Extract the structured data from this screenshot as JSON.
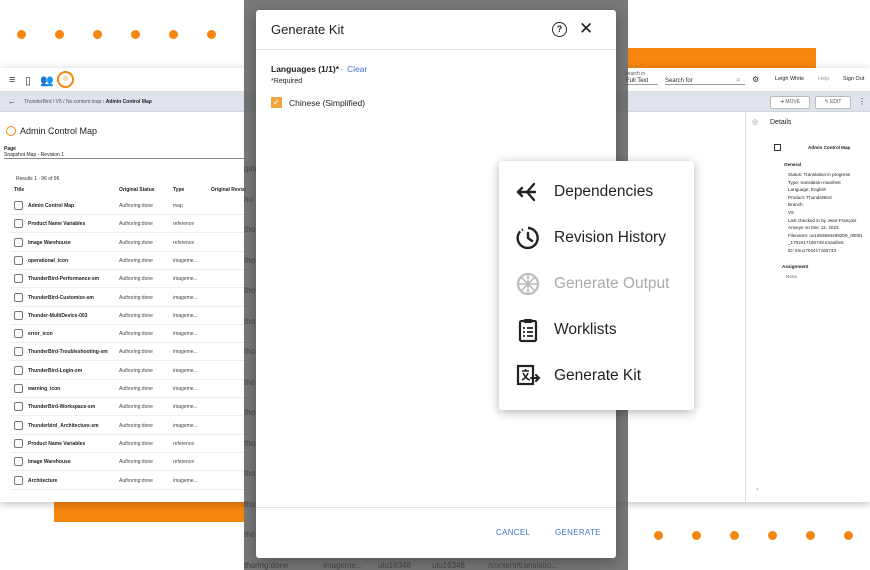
{
  "colors": {
    "accent": "#f5860f",
    "link": "#3b78c4",
    "checkbox": "#f0a33a"
  },
  "app": {
    "search": {
      "scope_label": "Search in",
      "scope_value": "Full Text",
      "placeholder": "Search for"
    },
    "user": "Leigh White",
    "help": "Help",
    "sign_out": "Sign Out",
    "breadcrumb_prefix": "ThunderBird / V5 / No content map  ›",
    "breadcrumb_current": "Admin Control Map",
    "move_label": "MOVE",
    "edit_label": "EDIT",
    "page_title": "Admin Control Map",
    "page_label": "Page",
    "page_value": "Snapshot Map - Revision 1",
    "results": "Results 1 - 96 of 96",
    "columns": [
      "Title",
      "Original Status",
      "Type",
      "Original Revisi"
    ],
    "rows": [
      {
        "title": "Admin Control Map",
        "status": "Authoring:done",
        "type": "map"
      },
      {
        "title": "Product Name Variables",
        "status": "Authoring:done",
        "type": "reference"
      },
      {
        "title": "Image Warehouse",
        "status": "Authoring:done",
        "type": "reference"
      },
      {
        "title": "operational_icon",
        "status": "Authoring:done",
        "type": "imageme..."
      },
      {
        "title": "ThunderBird-Performance-sm",
        "status": "Authoring:done",
        "type": "imageme..."
      },
      {
        "title": "ThunderBird-Customize-sm",
        "status": "Authoring:done",
        "type": "imageme..."
      },
      {
        "title": "Thunder-MultiDevice-003",
        "status": "Authoring:done",
        "type": "imageme..."
      },
      {
        "title": "error_icon",
        "status": "Authoring:done",
        "type": "imageme..."
      },
      {
        "title": "ThunderBird-Troubleshooting-sm",
        "status": "Authoring:done",
        "type": "imageme..."
      },
      {
        "title": "ThunderBird-Login-sm",
        "status": "Authoring:done",
        "type": "imageme..."
      },
      {
        "title": "warning_icon",
        "status": "Authoring:done",
        "type": "imageme..."
      },
      {
        "title": "ThunderBird-Workspace-sm",
        "status": "Authoring:done",
        "type": "imageme..."
      },
      {
        "title": "Thunderbird_Architecture-sm",
        "status": "Authoring:done",
        "type": "imageme..."
      },
      {
        "title": "Product Name Variables",
        "status": "Authoring:done",
        "type": "reference"
      },
      {
        "title": "Image Warehouse",
        "status": "Authoring:done",
        "type": "reference"
      },
      {
        "title": "Architecture",
        "status": "Authoring:done",
        "type": "imageme..."
      }
    ],
    "details": {
      "title": "Details",
      "item_name": "Admin Control Map",
      "general": "General",
      "lines": [
        "Status: Translation:in progress",
        "Type: translation-manifest",
        "Language: English",
        "Product: ThunderBird",
        "Branch:",
        "V5",
        "Last checked in by Jean-François",
        "Anneye on Dec 12, 2023",
        "Filename: uv1693594499209_00001",
        "_1702417160748.tmanifest",
        "ID: tmu1702417160733"
      ],
      "assignment": "Assignment",
      "assignment_value": "None"
    },
    "behind_text": {
      "left": [
        "gina",
        "ho",
        "tho",
        "tho",
        "tho",
        "tho",
        "tho",
        "tho",
        "tho",
        "tho",
        "tho",
        "tho",
        "tho",
        "tho"
      ],
      "footer": [
        "thoring:done",
        "imageme...",
        "ulu16348",
        "ulu16348",
        "/content/translatio..."
      ]
    }
  },
  "modal": {
    "title": "Generate Kit",
    "languages_label": "Languages (1/1)*",
    "separator": "-",
    "clear_label": "Clear",
    "required_note": "*Required",
    "language_option": "Chinese (Simplified)",
    "cancel_label": "CANCEL",
    "generate_label": "GENERATE"
  },
  "menu": {
    "items": [
      {
        "label": "Dependencies",
        "icon": "dependencies-icon",
        "enabled": true
      },
      {
        "label": "Revision History",
        "icon": "history-icon",
        "enabled": true
      },
      {
        "label": "Generate Output",
        "icon": "output-icon",
        "enabled": false
      },
      {
        "label": "Worklists",
        "icon": "worklist-icon",
        "enabled": true
      },
      {
        "label": "Generate Kit",
        "icon": "translate-icon",
        "enabled": true
      }
    ]
  }
}
